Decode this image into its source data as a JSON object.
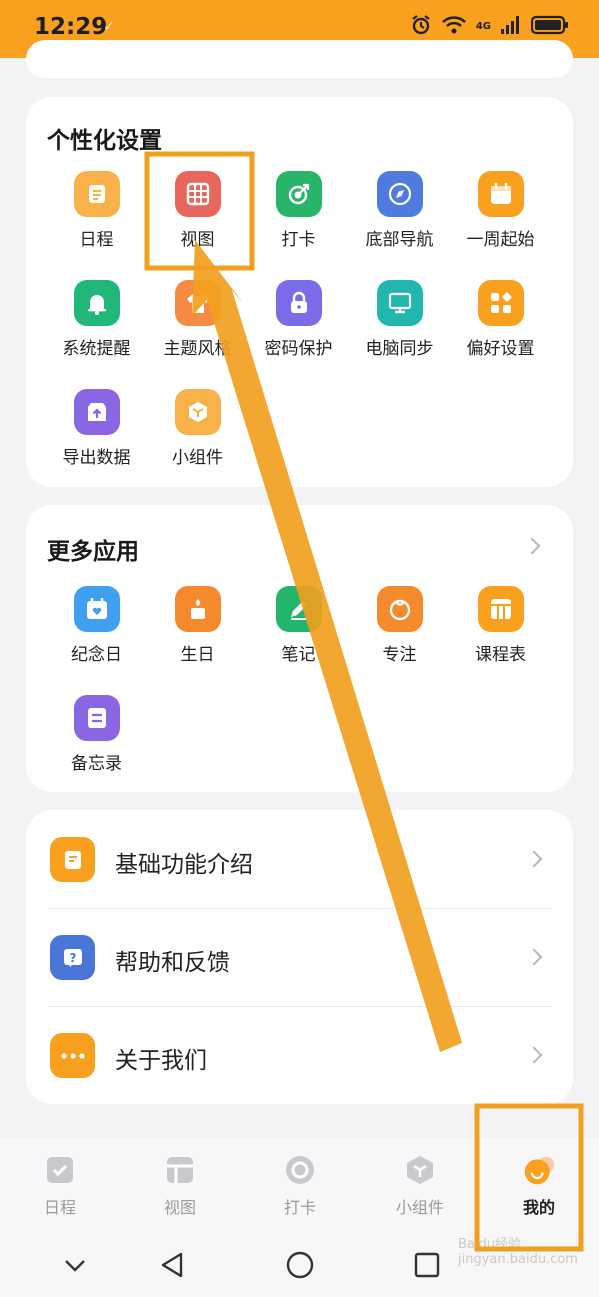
{
  "status_bar": {
    "time": "12:29",
    "network": "4G"
  },
  "personalization": {
    "title": "个性化设置",
    "items": [
      {
        "label": "日程",
        "icon": "schedule-icon",
        "color": "#f9b24a"
      },
      {
        "label": "视图",
        "icon": "grid-view-icon",
        "color": "#e8675d"
      },
      {
        "label": "打卡",
        "icon": "checkin-target-icon",
        "color": "#28b56a"
      },
      {
        "label": "底部导航",
        "icon": "compass-icon",
        "color": "#4f7bde"
      },
      {
        "label": "一周起始",
        "icon": "calendar-icon",
        "color": "#f9a11f"
      },
      {
        "label": "系统提醒",
        "icon": "bell-icon",
        "color": "#21b778"
      },
      {
        "label": "主题风格",
        "icon": "shirt-icon",
        "color": "#f58a45"
      },
      {
        "label": "密码保护",
        "icon": "lock-icon",
        "color": "#7a6ce8"
      },
      {
        "label": "电脑同步",
        "icon": "monitor-icon",
        "color": "#22b7ad"
      },
      {
        "label": "偏好设置",
        "icon": "preferences-icon",
        "color": "#f9a11f"
      },
      {
        "label": "导出数据",
        "icon": "export-icon",
        "color": "#8a66e3"
      },
      {
        "label": "小组件",
        "icon": "widget-cube-icon",
        "color": "#f9b24a"
      }
    ]
  },
  "more_apps": {
    "title": "更多应用",
    "items": [
      {
        "label": "纪念日",
        "icon": "anniversary-icon",
        "color": "#3f9ff0"
      },
      {
        "label": "生日",
        "icon": "birthday-cake-icon",
        "color": "#f58a2d"
      },
      {
        "label": "笔记",
        "icon": "pencil-icon",
        "color": "#24b56c"
      },
      {
        "label": "专注",
        "icon": "tomato-timer-icon",
        "color": "#f58a2d"
      },
      {
        "label": "课程表",
        "icon": "timetable-icon",
        "color": "#f9a11f"
      },
      {
        "label": "备忘录",
        "icon": "memo-icon",
        "color": "#8a66e3"
      }
    ]
  },
  "menu": [
    {
      "label": "基础功能介绍",
      "icon": "document-icon",
      "color": "#f9a11f"
    },
    {
      "label": "帮助和反馈",
      "icon": "help-icon",
      "color": "#4a76d8"
    },
    {
      "label": "关于我们",
      "icon": "more-dots-icon",
      "color": "#f9a11f"
    }
  ],
  "tabs": [
    {
      "label": "日程",
      "active": false
    },
    {
      "label": "视图",
      "active": false
    },
    {
      "label": "打卡",
      "active": false
    },
    {
      "label": "小组件",
      "active": false
    },
    {
      "label": "我的",
      "active": true
    }
  ],
  "watermark": "Baidu经验 jingyan.baidu.com",
  "colors": {
    "accent": "#f9a11f",
    "annotation": "#f0a01e"
  }
}
